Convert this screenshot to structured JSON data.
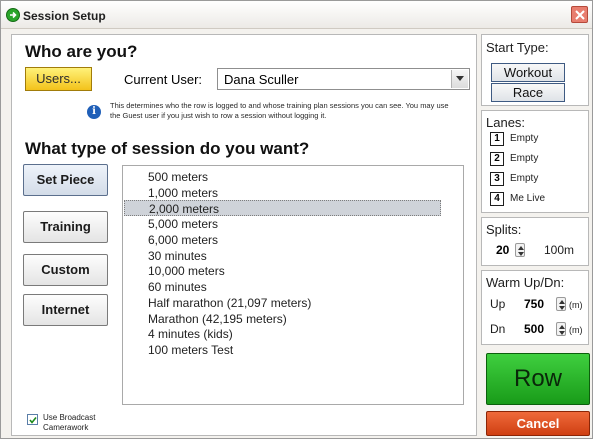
{
  "window": {
    "title": "Session Setup",
    "icon": "green-circle-arrow-icon"
  },
  "who": {
    "heading": "Who are you?",
    "users_label": "Users...",
    "current_user_label": "Current User:",
    "current_user_value": "Dana Sculler",
    "info_text": "This determines who the row is logged to and whose training plan sessions you can see. You may use the Guest user if you just wish to row a session without logging it."
  },
  "session": {
    "heading": "What type of session do you want?",
    "types": [
      "Set Piece",
      "Training",
      "Custom",
      "Internet"
    ],
    "selected_type": "Set Piece",
    "items": [
      "500 meters",
      "1,000 meters",
      "2,000 meters",
      "5,000 meters",
      "6,000 meters",
      "30 minutes",
      "10,000 meters",
      "60 minutes",
      "Half marathon (21,097 meters)",
      "Marathon (42,195 meters)",
      "4 minutes (kids)",
      "100 meters Test"
    ],
    "selected_item": "2,000 meters"
  },
  "broadcast": {
    "label": "Use Broadcast Camerawork",
    "checked": true
  },
  "start_type": {
    "title": "Start Type:",
    "workout": "Workout",
    "race": "Race"
  },
  "lanes": {
    "title": "Lanes:",
    "items": [
      {
        "num": "1",
        "name": "Empty"
      },
      {
        "num": "2",
        "name": "Empty"
      },
      {
        "num": "3",
        "name": "Empty"
      },
      {
        "num": "4",
        "name": "Me Live"
      }
    ]
  },
  "splits": {
    "title": "Splits:",
    "value": "20",
    "unit": "100m"
  },
  "warmup": {
    "title": "Warm Up/Dn:",
    "up_label": "Up",
    "up_value": "750",
    "dn_label": "Dn",
    "dn_value": "500",
    "unit": "(m)"
  },
  "actions": {
    "row": "Row",
    "cancel": "Cancel"
  },
  "colors": {
    "row_button": "#22a822",
    "cancel_button": "#e0501f",
    "users_button": "#f7d23a",
    "selection": "#cfd3d9"
  }
}
